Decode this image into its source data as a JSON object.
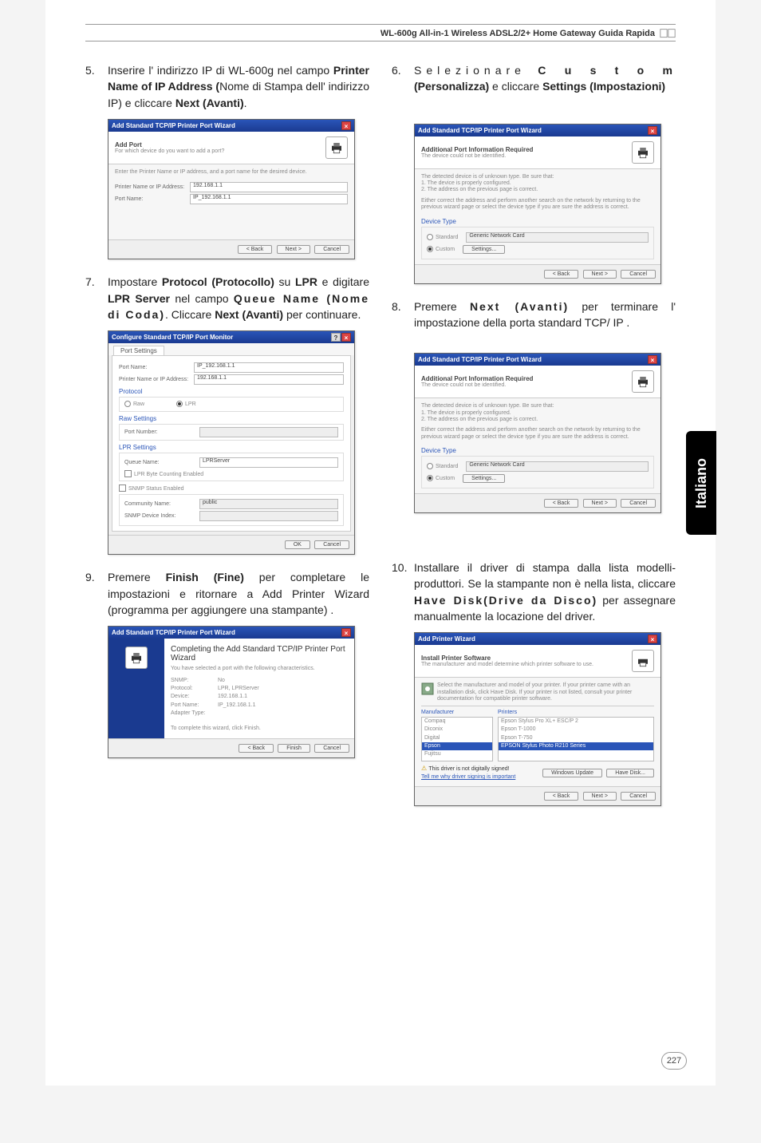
{
  "header": {
    "title": "WL-600g All-in-1 Wireless ADSL2/2+ Home Gateway Guida Rapida"
  },
  "left": {
    "step5": {
      "num": "5.",
      "text_a": "Inserire l' indirizzo IP di WL-600g nel campo ",
      "b1": "Printer Name of IP Address (",
      "text_b": "Nome di Stampa dell' indirizzo IP) e cliccare ",
      "b2": "Next (Avanti)",
      "dot": "."
    },
    "dlg6": {
      "title": "Add Standard TCP/IP Printer Port Wizard",
      "hd_main": "Add Port",
      "hd_sub": "For which device do you want to add a port?",
      "desc": "Enter the Printer Name or IP address, and a port name for the desired device.",
      "row1_label": "Printer Name or IP Address:",
      "row1_val": "192.168.1.1",
      "row2_label": "Port Name:",
      "row2_val": "IP_192.168.1.1",
      "back": "< Back",
      "next": "Next >",
      "cancel": "Cancel"
    },
    "step7": {
      "num": "7.",
      "text_a": "Impostare ",
      "b1": "Protocol (Protocollo)",
      "text_b": " su ",
      "b2": "LPR",
      "text_c": " e digitare ",
      "b3": "LPR Server",
      "text_d": " nel campo ",
      "b4": "Queue Name (Nome di Coda)",
      "text_e": ". Cliccare ",
      "b5": "Next (Avanti)",
      "text_f": " per continuare."
    },
    "dlg7": {
      "title": "Configure Standard TCP/IP Port Monitor",
      "tab": "Port Settings",
      "r1_label": "Port Name:",
      "r1_val": "IP_192.168.1.1",
      "r2_label": "Printer Name or IP Address:",
      "r2_val": "192.168.1.1",
      "proto": "Protocol",
      "raw": "Raw",
      "lpr": "LPR",
      "raws": "Raw Settings",
      "raws_label": "Port Number:",
      "lprs": "LPR Settings",
      "lprs_label": "Queue Name:",
      "lprs_val": "LPRServer",
      "lprbc": "LPR Byte Counting Enabled",
      "snmp": "SNMP Status Enabled",
      "cn_label": "Community Name:",
      "cn_val": "public",
      "idx_label": "SNMP Device Index:",
      "ok": "OK",
      "cancel": "Cancel"
    },
    "step9": {
      "num": "9.",
      "text_a": "Premere ",
      "b1": "Finish (Fine)",
      "text_b": " per completare le impostazioni e ritornare a Add Printer Wizard (programma per aggiungere una stampante) ."
    },
    "dlg9": {
      "title": "Add Standard TCP/IP Printer Port Wizard",
      "h1": "Completing the Add Standard TCP/IP Printer Port Wizard",
      "sub": "You have selected a port with the following characteristics.",
      "snmp": "SNMP:",
      "snmp_v": "No",
      "proto": "Protocol:",
      "proto_v": "LPR, LPRServer",
      "dev": "Device:",
      "dev_v": "192.168.1.1",
      "pn": "Port Name:",
      "pn_v": "IP_192.168.1.1",
      "at": "Adapter Type:",
      "close_txt": "To complete this wizard, click Finish.",
      "back": "< Back",
      "finish": "Finish",
      "cancel": "Cancel"
    }
  },
  "right": {
    "step6": {
      "num": "6.",
      "text_a": "Selezionare",
      "b1": "Custom (Personalizza)",
      "text_b": "  e cliccare ",
      "b2": "Settings (Impostazioni)"
    },
    "dlg6": {
      "title": "Add Standard TCP/IP Printer Port Wizard",
      "hd_main": "Additional Port Information Required",
      "hd_sub": "The device could not be identified.",
      "line1": "The detected device is of unknown type. Be sure that:",
      "line2": "1. The device is properly configured.",
      "line3": "2. The address on the previous page is correct.",
      "para": "Either correct the address and perform another search on the network by returning to the previous wizard page or select the device type if you are sure the address is correct.",
      "dt": "Device Type",
      "std": "Standard",
      "std_v": "Generic Network Card",
      "cus": "Custom",
      "set": "Settings...",
      "back": "< Back",
      "next": "Next >",
      "cancel": "Cancel"
    },
    "step8": {
      "num": "8.",
      "text_a": "Premere ",
      "b1": "Next (Avanti)",
      "text_b": " per terminare l' impostazione della porta standard TCP/ IP ."
    },
    "step10": {
      "num": "10.",
      "text_a": "Installare il driver di stampa dalla lista modelli-produttori. Se la stampante non è nella lista, cliccare ",
      "b1": "Have Disk(Drive da Disco)",
      "text_b": " per assegnare manualmente la locazione del driver."
    },
    "dlg10": {
      "title": "Add Printer Wizard",
      "hd_main": "Install Printer Software",
      "hd_sub": "The manufacturer and model determine which printer software to use.",
      "para": "Select the manufacturer and model of your printer. If your printer came with an installation disk, click Have Disk. If your printer is not listed, consult your printer documentation for compatible printer software.",
      "mfg": "Manufacturer",
      "prt": "Printers",
      "m1": "Compaq",
      "m2": "Diconix",
      "m3": "Digital",
      "m4": "Epson",
      "m5": "Fujitsu",
      "p1": "Epson Stylus Pro XL+ ESC/P 2",
      "p2": "Epson T-1000",
      "p3": "Epson T-750",
      "p4": "EPSON Stylus Photo R210 Series",
      "sig": "This driver is not digitally signed!",
      "tell": "Tell me why driver signing is important",
      "wu": "Windows Update",
      "hd": "Have Disk...",
      "back": "< Back",
      "next": "Next >",
      "cancel": "Cancel"
    }
  },
  "sidetab": "Italiano",
  "pagenum": "227"
}
